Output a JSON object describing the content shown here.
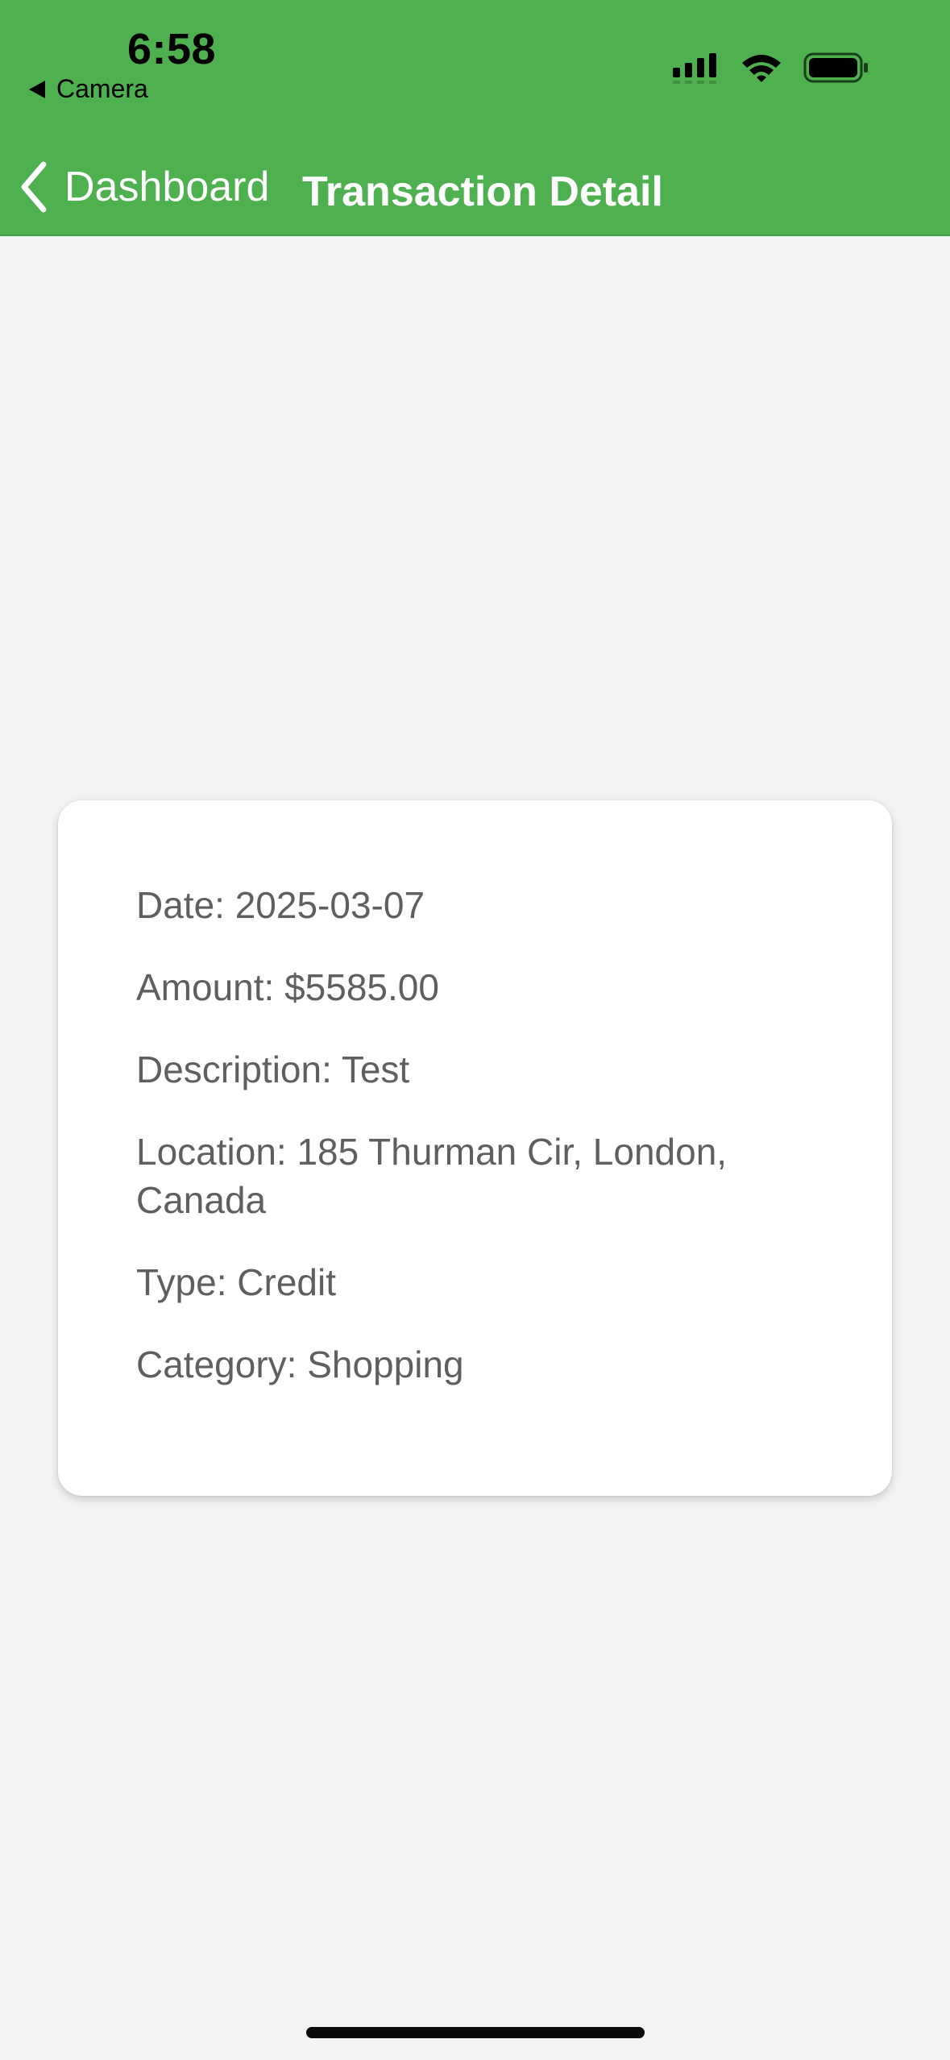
{
  "status_bar": {
    "time": "6:58",
    "back_app": "Camera",
    "icons": [
      "back-arrow-icon",
      "signal-icon",
      "wifi-icon",
      "battery-icon"
    ]
  },
  "nav": {
    "back_label": "Dashboard",
    "title": "Transaction Detail"
  },
  "transaction": {
    "date": "Date: 2025-03-07",
    "amount": "Amount: $5585.00",
    "description": "Description: Test",
    "location": "Location: 185 Thurman Cir, London, Canada",
    "type": "Type: Credit",
    "category": "Category: Shopping"
  },
  "colors": {
    "header": "#4fb050",
    "background": "#f3f3f3",
    "card": "#ffffff",
    "text": "#5f5f5f"
  }
}
